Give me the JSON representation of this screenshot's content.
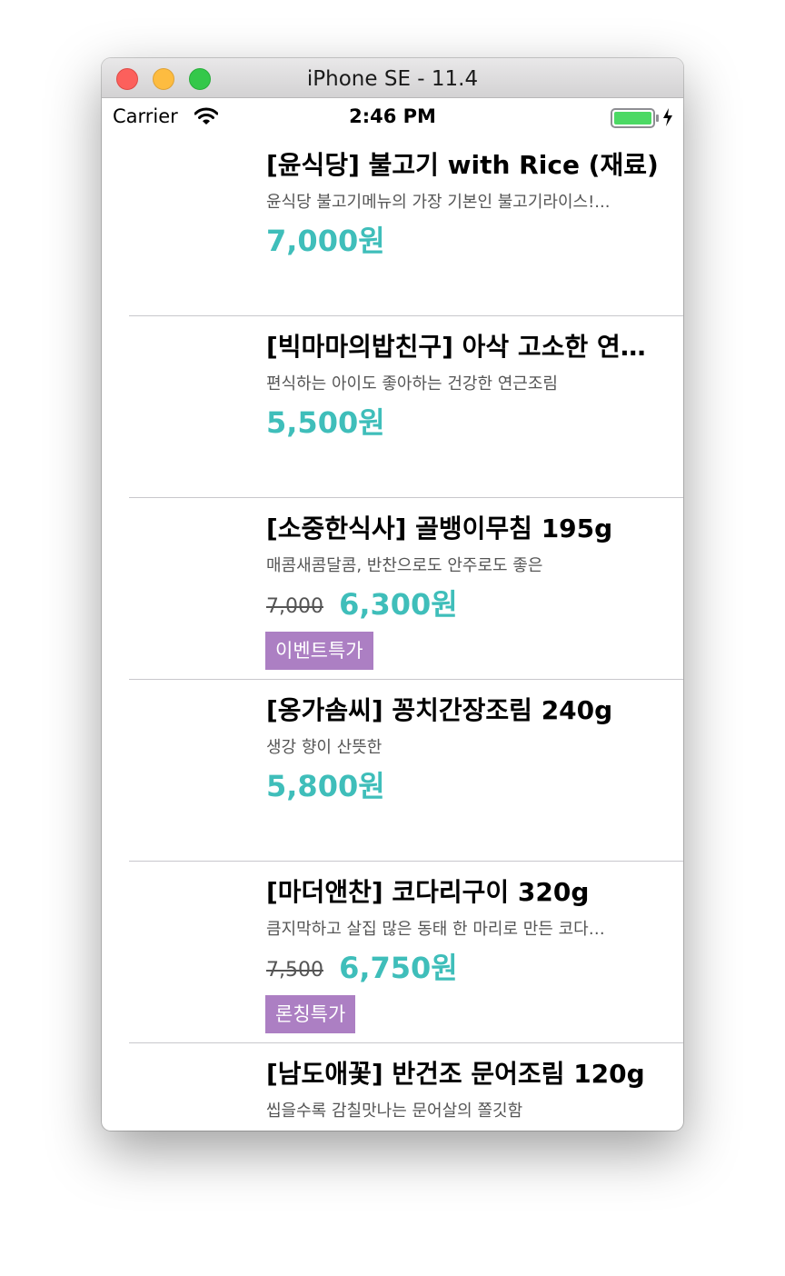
{
  "window": {
    "title": "iPhone SE - 11.4"
  },
  "status_bar": {
    "carrier": "Carrier",
    "time": "2:46 PM",
    "wifi_icon": "wifi-icon",
    "battery_icon": "battery-icon",
    "charging_icon": "charging-icon",
    "battery_color": "#4cd964"
  },
  "colors": {
    "price": "#3fbeba",
    "badge": "#ac7fc3",
    "divider": "#c8c7cc"
  },
  "products": [
    {
      "title": "[윤식당] 불고기 with Rice (재료)",
      "description": "윤식당 불고기메뉴의 가장 기본인 불고기라이스!...",
      "original_price": "",
      "price": "7,000원",
      "badge": ""
    },
    {
      "title": "[빅마마의밥친구] 아삭 고소한 연…",
      "description": "편식하는 아이도 좋아하는 건강한 연근조림",
      "original_price": "",
      "price": "5,500원",
      "badge": ""
    },
    {
      "title": "[소중한식사] 골뱅이무침 195g",
      "description": "매콤새콤달콤, 반찬으로도 안주로도 좋은",
      "original_price": "7,000",
      "price": "6,300원",
      "badge": "이벤트특가"
    },
    {
      "title": "[옹가솜씨] 꽁치간장조림 240g",
      "description": "생강 향이 산뜻한",
      "original_price": "",
      "price": "5,800원",
      "badge": ""
    },
    {
      "title": "[마더앤찬] 코다리구이 320g",
      "description": "큼지막하고 살집 많은 동태 한 마리로 만든 코다…",
      "original_price": "7,500",
      "price": "6,750원",
      "badge": "론칭특가"
    },
    {
      "title": "[남도애꽃] 반건조 문어조림 120g",
      "description": "씹을수록 감칠맛나는 문어살의 쫄깃함",
      "original_price": "",
      "price": "",
      "badge": ""
    }
  ]
}
